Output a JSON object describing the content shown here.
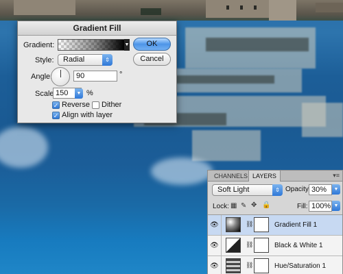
{
  "dialog": {
    "title": "Gradient Fill",
    "gradient_label": "Gradient:",
    "style_label": "Style:",
    "style_value": "Radial",
    "angle_label": "Angle:",
    "angle_value": "90",
    "angle_unit": "°",
    "scale_label": "Scale:",
    "scale_value": "150",
    "scale_unit": "%",
    "reverse_label": "Reverse",
    "reverse_checked": true,
    "dither_label": "Dither",
    "dither_checked": false,
    "align_label": "Align with layer",
    "align_checked": true,
    "ok_label": "OK",
    "cancel_label": "Cancel"
  },
  "panel": {
    "tabs": [
      "CHANNELS",
      "LAYERS"
    ],
    "active_tab": "LAYERS",
    "blend_mode": "Soft Light",
    "opacity_label": "Opacity:",
    "opacity_value": "30%",
    "lock_label": "Lock:",
    "fill_label": "Fill:",
    "fill_value": "100%",
    "layers": [
      {
        "name": "Gradient Fill 1",
        "selected": true,
        "icon": "gradient-fill-thumbnail"
      },
      {
        "name": "Black & White 1",
        "selected": false,
        "icon": "adjustment-thumbnail"
      },
      {
        "name": "Hue/Saturation 1",
        "selected": false,
        "icon": "adjustment-thumbnail"
      }
    ]
  },
  "colors": {
    "water": "#1b5d98",
    "panel": "#d6d6d6",
    "selection": "#c7d9f2",
    "accent": "#2f78d8"
  }
}
